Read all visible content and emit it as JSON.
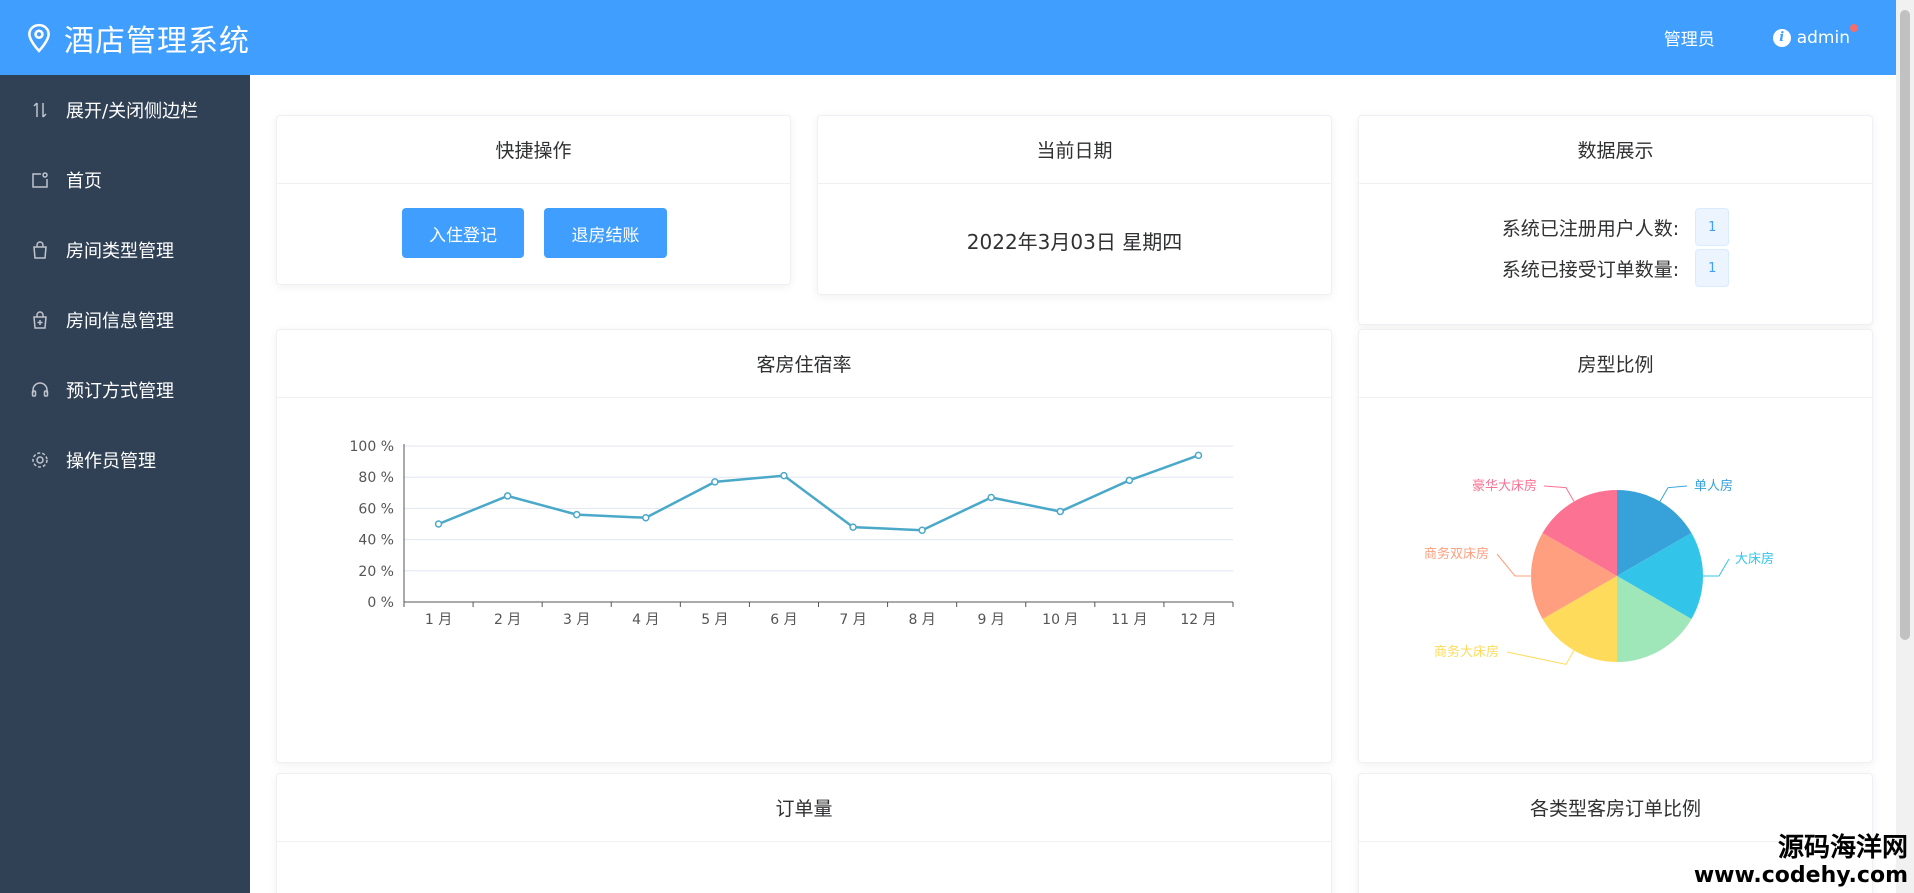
{
  "header": {
    "app_title": "酒店管理系统",
    "role_label": "管理员",
    "username": "admin",
    "info_glyph": "i"
  },
  "sidebar": {
    "items": [
      {
        "label": "展开/关闭侧边栏",
        "icon": "sort-icon"
      },
      {
        "label": "首页",
        "icon": "home-icon"
      },
      {
        "label": "房间类型管理",
        "icon": "bag-icon"
      },
      {
        "label": "房间信息管理",
        "icon": "bag-add-icon"
      },
      {
        "label": "预订方式管理",
        "icon": "headset-icon"
      },
      {
        "label": "操作员管理",
        "icon": "settings-icon"
      }
    ]
  },
  "quick": {
    "title": "快捷操作",
    "checkin_label": "入住登记",
    "checkout_label": "退房结账"
  },
  "date_card": {
    "title": "当前日期",
    "date": "2022年3月03日 星期四"
  },
  "stats": {
    "title": "数据展示",
    "users_label": "系统已注册用户人数:",
    "users_value": "1",
    "orders_label": "系统已接受订单数量:",
    "orders_value": "1"
  },
  "occupancy_title": "客房住宿率",
  "roomtype_title": "房型比例",
  "orders_title": "订单量",
  "order_ratio_title": "各类型客房订单比例",
  "chart_data": [
    {
      "type": "line",
      "title": "客房住宿率",
      "categories": [
        "1 月",
        "2 月",
        "3 月",
        "4 月",
        "5 月",
        "6 月",
        "7 月",
        "8 月",
        "9 月",
        "10 月",
        "11 月",
        "12 月"
      ],
      "values": [
        50,
        68,
        56,
        54,
        77,
        81,
        48,
        46,
        67,
        58,
        78,
        94
      ],
      "y_ticks": [
        "0 %",
        "20 %",
        "40 %",
        "60 %",
        "80 %",
        "100 %"
      ],
      "ylim": [
        0,
        100
      ],
      "grid": true,
      "color": "#4aa8c9"
    },
    {
      "type": "pie",
      "title": "房型比例",
      "slices": [
        {
          "name": "单人房",
          "value": 1,
          "color": "#37a2da"
        },
        {
          "name": "大床房",
          "value": 1,
          "color": "#32c5e9"
        },
        {
          "name": "",
          "value": 1,
          "color": "#9fe6b8"
        },
        {
          "name": "商务大床房",
          "value": 1,
          "color": "#ffdb5c"
        },
        {
          "name": "商务双床房",
          "value": 1,
          "color": "#ff9f7f"
        },
        {
          "name": "豪华大床房",
          "value": 1,
          "color": "#fb7293"
        }
      ]
    }
  ],
  "watermark": {
    "line1": "源码海洋网",
    "line2": "www.codehy.com"
  },
  "colors": {
    "primary": "#409eff",
    "sidebar": "#304156"
  }
}
